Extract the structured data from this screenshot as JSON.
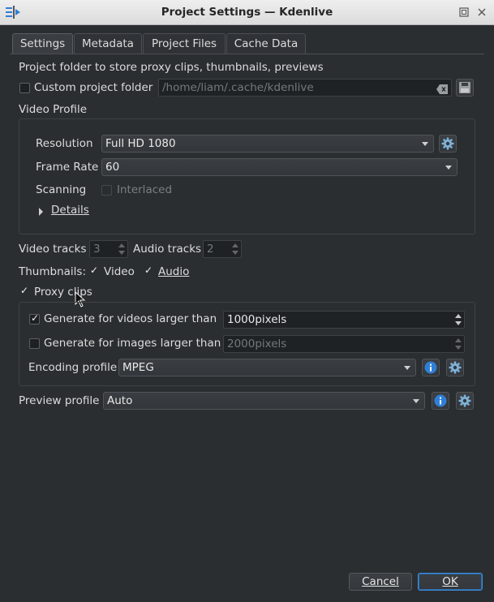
{
  "window": {
    "title": "Project Settings — Kdenlive",
    "app_icon": "kdenlive-icon",
    "controls": [
      "restore-icon",
      "close-icon"
    ]
  },
  "tabs": [
    {
      "label": "Settings",
      "active": true
    },
    {
      "label": "Metadata",
      "active": false
    },
    {
      "label": "Project Files",
      "active": false
    },
    {
      "label": "Cache Data",
      "active": false
    }
  ],
  "settings": {
    "folder_heading": "Project folder to store proxy clips, thumbnails, previews",
    "custom_folder": {
      "label": "Custom project folder",
      "checked": false,
      "path": "/home/liam/.cache/kdenlive"
    },
    "video_profile": {
      "heading": "Video Profile",
      "resolution_label": "Resolution",
      "resolution_value": "Full HD 1080",
      "frame_rate_label": "Frame Rate",
      "frame_rate_value": "60",
      "scanning_label": "Scanning",
      "interlaced_label": "Interlaced",
      "interlaced_checked": false,
      "details_label": "Details"
    },
    "tracks": {
      "video_label": "Video tracks",
      "video_value": "3",
      "audio_label": "Audio tracks",
      "audio_value": "2"
    },
    "thumbnails": {
      "label": "Thumbnails:",
      "video_label": "Video",
      "video_checked": true,
      "audio_label": "Audio",
      "audio_checked": true
    },
    "proxy": {
      "label": "Proxy clips",
      "checked": true,
      "videos_label": "Generate for videos larger than",
      "videos_checked": true,
      "videos_value": "1000pixels",
      "images_label": "Generate for images larger than",
      "images_checked": false,
      "images_value": "2000pixels",
      "encoding_label": "Encoding profile",
      "encoding_value": "MPEG"
    },
    "preview": {
      "label": "Preview profile",
      "value": "Auto"
    }
  },
  "buttons": {
    "cancel": "Cancel",
    "ok": "OK"
  },
  "colors": {
    "background": "#2b2e31",
    "accent": "#3d8ee0",
    "info_blue": "#2f7fd6"
  }
}
